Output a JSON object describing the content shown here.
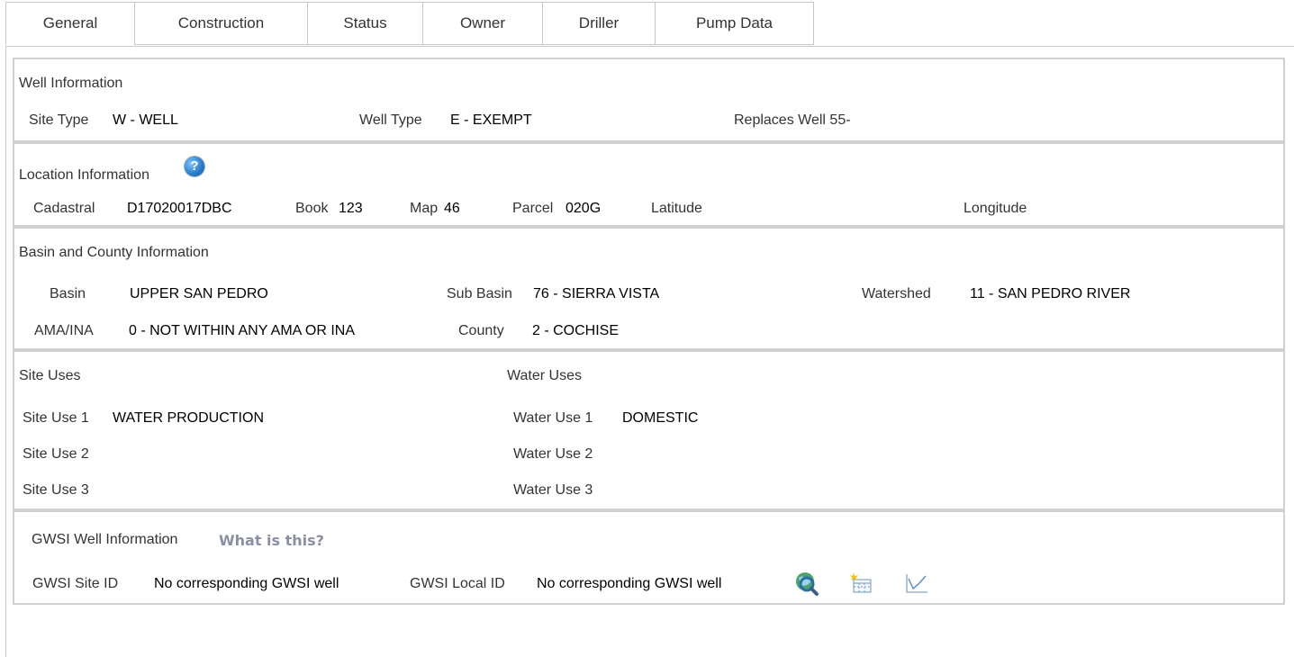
{
  "tabs": [
    "General",
    "Construction",
    "Status",
    "Owner",
    "Driller",
    "Pump Data"
  ],
  "well_info": {
    "header": "Well Information",
    "site_type_label": "Site Type",
    "site_type": "W - WELL",
    "well_type_label": "Well Type",
    "well_type": "E - EXEMPT",
    "replaces_label": "Replaces Well 55-"
  },
  "location": {
    "header": "Location Information",
    "help_icon": "question-circle-icon",
    "cadastral_label": "Cadastral",
    "cadastral": "D17020017DBC",
    "book_label": "Book",
    "book": "123",
    "map_label": "Map",
    "map": "46",
    "parcel_label": "Parcel",
    "parcel": "020G",
    "latitude_label": "Latitude",
    "longitude_label": "Longitude"
  },
  "basin": {
    "header": "Basin and County Information",
    "basin_label": "Basin",
    "basin": "UPPER SAN PEDRO",
    "sub_basin_label": "Sub Basin",
    "sub_basin": "76 - SIERRA VISTA",
    "watershed_label": "Watershed",
    "watershed": "11 - SAN PEDRO RIVER",
    "ama_label": "AMA/INA",
    "ama": "0 - NOT WITHIN ANY AMA OR INA",
    "county_label": "County",
    "county": "2 - COCHISE"
  },
  "uses": {
    "site_header": "Site Uses",
    "water_header": "Water Uses",
    "site_use_1_label": "Site Use 1",
    "site_use_1": "WATER PRODUCTION",
    "site_use_2_label": "Site Use 2",
    "site_use_3_label": "Site Use 3",
    "water_use_1_label": "Water Use 1",
    "water_use_1": "DOMESTIC",
    "water_use_2_label": "Water Use 2",
    "water_use_3_label": "Water Use 3"
  },
  "gwsi": {
    "header": "GWSI Well Information",
    "what_link": "What is this?",
    "site_id_label": "GWSI Site ID",
    "site_id": "No corresponding GWSI well",
    "local_id_label": "GWSI Local ID",
    "local_id": "No corresponding GWSI well",
    "icons": [
      "magnify-globe-icon",
      "new-table-icon",
      "line-chart-icon"
    ]
  }
}
